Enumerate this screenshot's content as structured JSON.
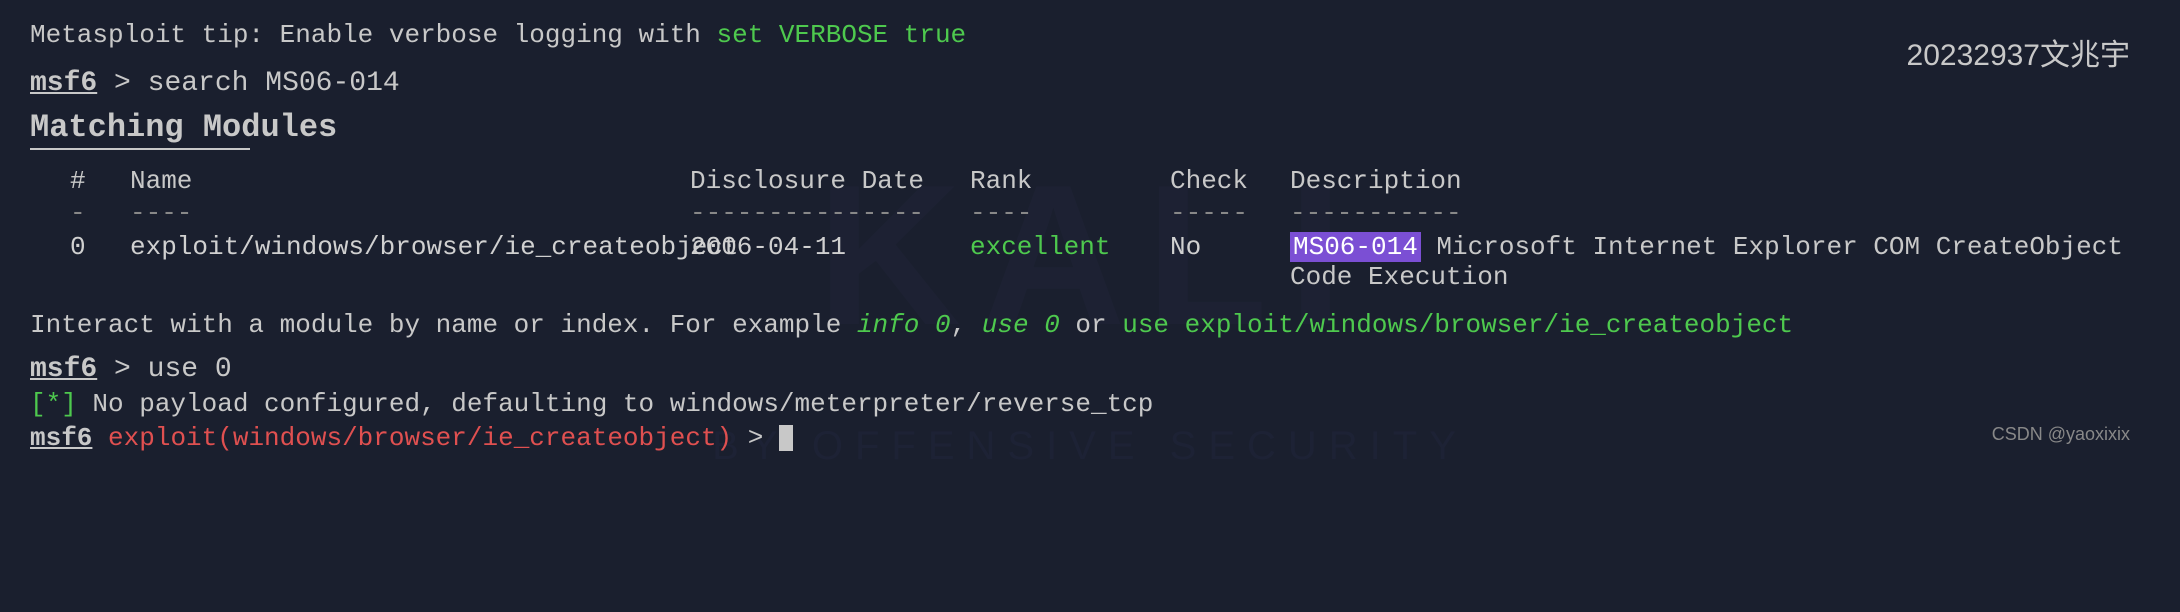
{
  "terminal": {
    "tip": {
      "prefix": "Metasploit tip: Enable verbose logging with ",
      "command": "set VERBOSE true"
    },
    "search_prompt": {
      "msf6": "msf6",
      "gt": " > ",
      "command": "search MS06-014"
    },
    "matching_heading": "Matching Modules",
    "table": {
      "headers": [
        "#",
        "Name",
        "Disclosure Date",
        "Rank",
        "Check",
        "Description"
      ],
      "separators": [
        "-",
        "----",
        "---------------",
        "----",
        "-----",
        "-----------"
      ],
      "rows": [
        {
          "num": "0",
          "name": "exploit/windows/browser/ie_createobject",
          "date": "2006-04-11",
          "rank": "excellent",
          "check": "No",
          "desc_highlight": "MS06-014",
          "desc_rest": " Microsoft Internet Explorer COM CreateObject Code Execution"
        }
      ]
    },
    "interact_line": {
      "prefix": "Interact with a module by name or index. For example ",
      "example1": "info 0",
      "middle": ", ",
      "example2": "use 0",
      "or": " or ",
      "example3": "use exploit/windows/browser/ie_createobject"
    },
    "use_prompt": {
      "msf6": "msf6",
      "gt": " > ",
      "command": "use 0"
    },
    "star_line": {
      "bracket": "[*]",
      "text": " No payload configured, defaulting to windows/meterpreter/reverse_tcp"
    },
    "final_prompt": {
      "msf6": "msf6",
      "space": " ",
      "exploit": "exploit(windows/browser/ie_createobject)",
      "gt": " > "
    }
  },
  "corner_label": "20232937文兆宇",
  "bottom_right": "CSDN @yaoxixix"
}
